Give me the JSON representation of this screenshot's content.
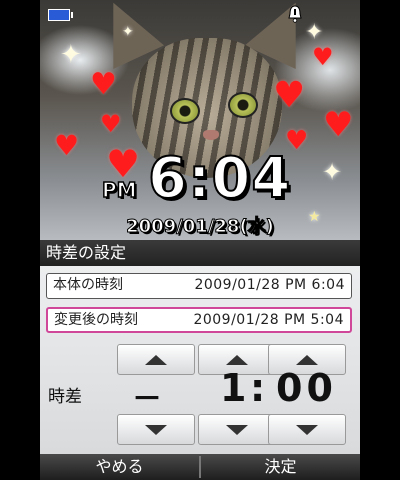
{
  "lock_screen": {
    "ampm": "PM",
    "time": "6:04",
    "date": "2009/01/28(水)"
  },
  "panel": {
    "title": "時差の設定",
    "device_time": {
      "label": "本体の時刻",
      "value": "2009/01/28  PM  6:04"
    },
    "changed_time": {
      "label": "変更後の時刻",
      "value": "2009/01/28  PM  5:04"
    },
    "difference": {
      "label": "時差",
      "sign": "－",
      "hours": "1",
      "minutes": "00"
    }
  },
  "softkeys": {
    "left": "やめる",
    "right": "決定"
  },
  "icons": {
    "battery": "battery-icon",
    "alert": "alert-bell-icon",
    "up": "arrow-up-icon",
    "down": "arrow-down-icon"
  },
  "colors": {
    "focus_border": "#d0479a",
    "battery": "#2a5bd7",
    "hearts": "#ff1c1c"
  }
}
